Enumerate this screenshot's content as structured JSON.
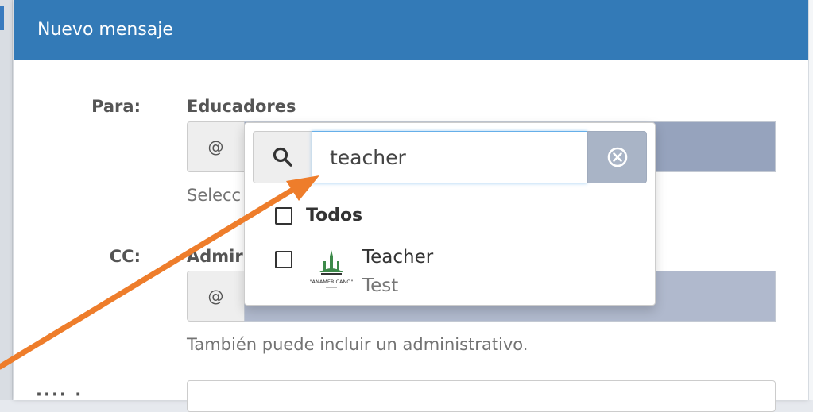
{
  "modal": {
    "title": "Nuevo mensaje"
  },
  "form": {
    "to": {
      "label": "Para:",
      "group": "Educadores",
      "addon": "@",
      "help_partial": "Selecc"
    },
    "cc": {
      "label": "CC:",
      "group_partial": "Admir",
      "addon": "@",
      "help": "También puede incluir un administrativo."
    },
    "next_label_partial": "···· ·"
  },
  "dropdown": {
    "search_value": "teacher",
    "select_all_label": "Todos",
    "options": [
      {
        "name": "Teacher",
        "subtitle": "Test",
        "checked": false
      }
    ],
    "logo_text": "\"ANAMERICANO\""
  },
  "colors": {
    "header": "#337ab7",
    "arrow": "#ee7d2b",
    "clear_button": "#a9b4c6"
  }
}
